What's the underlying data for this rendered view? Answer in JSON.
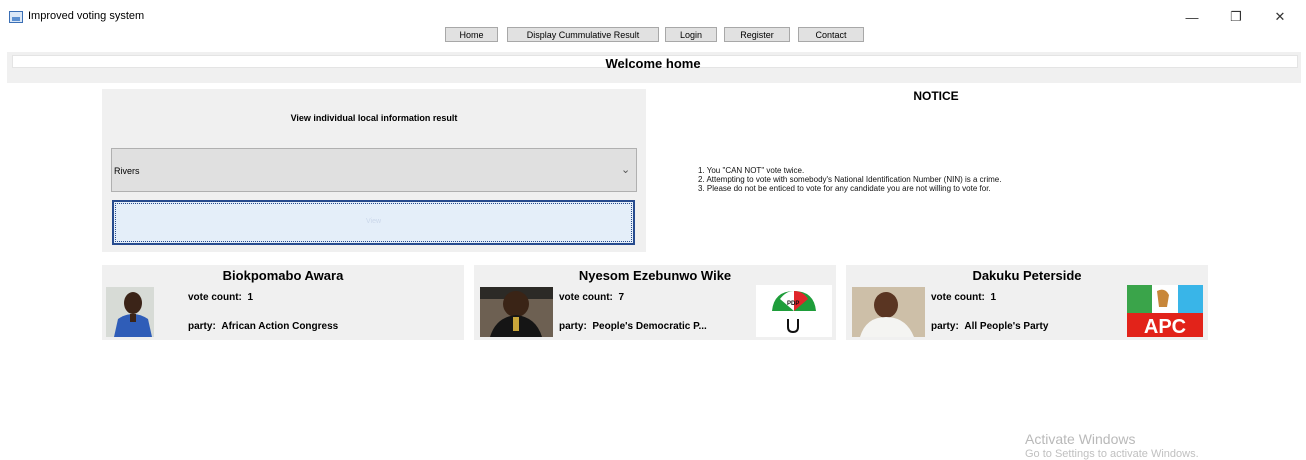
{
  "window": {
    "title": "Improved voting system",
    "controls": {
      "minimize": "—",
      "restore": "❐",
      "close": "✕"
    }
  },
  "nav": {
    "items": [
      "Home",
      "Display Cummulative Result",
      "Login",
      "Register",
      "Contact"
    ]
  },
  "header": {
    "welcome": "Welcome home"
  },
  "local_result": {
    "title": "View individual local information result",
    "state_select": {
      "selected": "Rivers"
    },
    "view_button_label": "View"
  },
  "notice": {
    "title": "NOTICE",
    "items": [
      "1. You \"CAN NOT\" vote twice.",
      "2.  Attempting to vote with somebody's National Identification Number (NIN) is a crime.",
      "3. Please do not be enticed to vote for any candidate you are not willing to vote for."
    ]
  },
  "candidates": [
    {
      "name": "Biokpomabo Awara",
      "vote_label": "vote count:",
      "vote_count": "1",
      "party_label": "party:",
      "party": "African Action Congress",
      "logo": ""
    },
    {
      "name": "Nyesom Ezebunwo Wike",
      "vote_label": "vote count:",
      "vote_count": "7",
      "party_label": "party:",
      "party": "People's Democratic P...",
      "logo": "PDP"
    },
    {
      "name": "Dakuku Peterside",
      "vote_label": "vote count:",
      "vote_count": "1",
      "party_label": "party:",
      "party": "All People's Party",
      "logo": "APC"
    }
  ],
  "watermark": {
    "line1": "Activate Windows",
    "line2": "Go to Settings to activate Windows."
  },
  "colors": {
    "panel": "#f0f0f0",
    "view_button_border": "#274b8e",
    "pdp_green": "#1e9d3a",
    "pdp_red": "#e0262a",
    "apc_red": "#e2231a",
    "apc_green": "#3aa44a",
    "apc_blue": "#39b5e8"
  }
}
